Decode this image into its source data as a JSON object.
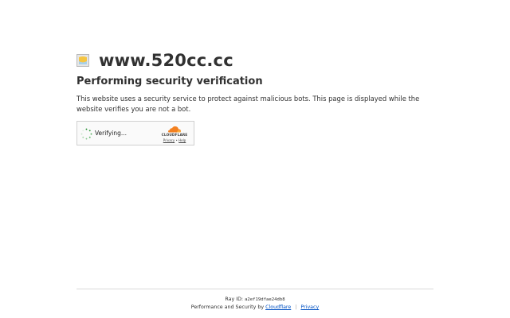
{
  "site": {
    "name": "www.520cc.cc",
    "favicon_icon": "site-favicon-icon"
  },
  "challenge": {
    "heading": "Performing security verification",
    "description": "This website uses a security service to protect against malicious bots. This page is displayed while the website verifies you are not a bot."
  },
  "widget": {
    "status_label": "Verifying...",
    "brand": "CLOUDFLARE",
    "privacy_link": "Privacy",
    "links_separator": "•",
    "help_link": "Help",
    "spinner_icon": "spinner-icon",
    "brand_color": "#f38020"
  },
  "footer": {
    "ray_label": "Ray ID:",
    "ray_id": "a2ef19dfae24db8",
    "performance_prefix": "Performance and Security by",
    "cloudflare_link": "Cloudflare",
    "separator": "|",
    "privacy_link": "Privacy",
    "link_color": "#0051c3"
  }
}
